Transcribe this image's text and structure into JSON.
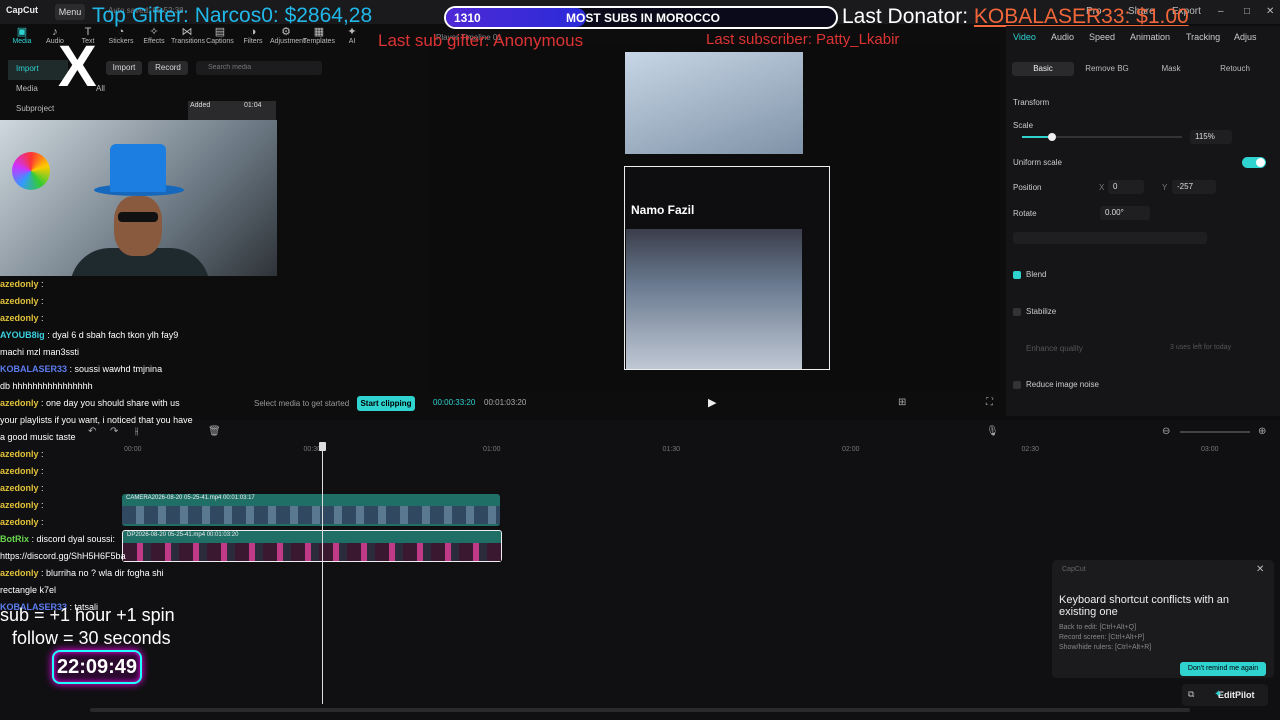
{
  "app": {
    "name": "CapCut",
    "menu_label": "Menu",
    "autosave": "Auto saved: 05:52:38"
  },
  "window_buttons": [
    "Pro",
    "Share",
    "Export"
  ],
  "tool_tabs": [
    {
      "label": "Media",
      "icon": "media-icon",
      "active": true
    },
    {
      "label": "Audio",
      "icon": "audio-icon"
    },
    {
      "label": "Text",
      "icon": "text-icon"
    },
    {
      "label": "Stickers",
      "icon": "stickers-icon"
    },
    {
      "label": "Effects",
      "icon": "effects-icon"
    },
    {
      "label": "Transitions",
      "icon": "transitions-icon"
    },
    {
      "label": "Captions",
      "icon": "captions-icon"
    },
    {
      "label": "Filters",
      "icon": "filters-icon"
    },
    {
      "label": "Adjustment",
      "icon": "adjustment-icon"
    },
    {
      "label": "Templates",
      "icon": "templates-icon"
    },
    {
      "label": "AI",
      "icon": "ai-icon"
    }
  ],
  "left_nav": [
    {
      "label": "Import",
      "active": true
    },
    {
      "label": "Media"
    },
    {
      "label": "Subproject"
    }
  ],
  "media_toolbar": {
    "import": "Import",
    "record": "Record",
    "search_placeholder": "Search media",
    "filter_all": "All"
  },
  "media_items": [
    {
      "badge": "Added",
      "duration": "01:04"
    }
  ],
  "overlay": {
    "top_gifter": "Top Gifter: Narcos0: $2864,28",
    "sub_count": "1310",
    "sub_goal": "MOST SUBS IN MOROCCO",
    "sub_goal_progress": 0.36,
    "last_donator_label": "Last Donator:",
    "last_donator_value": "KOBALASER33: $1.00",
    "last_sub_gifter": "Last sub gifter: Anonymous",
    "last_subscriber": "Last subscriber: Patty_Lkabir",
    "sub_rules_1": "sub  = +1 hour +1 spin",
    "sub_rules_2": "follow = 30 seconds",
    "timer": "22:09:49"
  },
  "chat": [
    {
      "name": "azedonly",
      "msg": ":",
      "color": "yellow"
    },
    {
      "name": "azedonly",
      "msg": ":",
      "color": "yellow"
    },
    {
      "name": "azedonly",
      "msg": ":",
      "color": "yellow"
    },
    {
      "name": "AYOUB8ig",
      "msg": ": dyal 6 d sbah fach tkon ylh fay9",
      "color": "cyan"
    },
    {
      "name": "",
      "msg": "machi mzl man3ssti",
      "color": "yellow"
    },
    {
      "name": "KOBALASER33",
      "msg": ": soussi wawhd tmjnina",
      "color": "blue"
    },
    {
      "name": "",
      "msg": "db hhhhhhhhhhhhhhhh",
      "color": "yellow"
    },
    {
      "name": "azedonly",
      "msg": ": one day you should share with us",
      "color": "yellow"
    },
    {
      "name": "",
      "msg": "your playlists if you want, i noticed that you have",
      "color": "yellow"
    },
    {
      "name": "",
      "msg": "a good music taste",
      "color": "yellow"
    },
    {
      "name": "azedonly",
      "msg": ":",
      "color": "yellow"
    },
    {
      "name": "azedonly",
      "msg": ":",
      "color": "yellow"
    },
    {
      "name": "azedonly",
      "msg": ":",
      "color": "yellow"
    },
    {
      "name": "azedonly",
      "msg": ":",
      "color": "yellow"
    },
    {
      "name": "azedonly",
      "msg": ":",
      "color": "yellow"
    },
    {
      "name": "BotRix",
      "msg": ": discord dyal soussi:",
      "color": "green"
    },
    {
      "name": "",
      "msg": "https://discord.gg/ShH5H6F5ba",
      "color": "yellow"
    },
    {
      "name": "azedonly",
      "msg": ": blurriha no ? wla dir fogha shi",
      "color": "yellow"
    },
    {
      "name": "",
      "msg": "rectangle k7el",
      "color": "yellow"
    },
    {
      "name": "KOBALASER33",
      "msg": ": tatsali",
      "color": "blue"
    }
  ],
  "player": {
    "title": "Player  Timeline 01",
    "caption": "Namo Fazil",
    "time_current": "00:00:33:20",
    "time_total": "00:01:03:20",
    "select_media": "Select media to get started",
    "start_clipping": "Start clipping"
  },
  "right_panel": {
    "tabs": [
      {
        "label": "Video",
        "active": true
      },
      {
        "label": "Audio"
      },
      {
        "label": "Speed"
      },
      {
        "label": "Animation"
      },
      {
        "label": "Tracking"
      },
      {
        "label": "Adjus"
      }
    ],
    "subtabs": [
      {
        "label": "Basic",
        "active": true
      },
      {
        "label": "Remove BG"
      },
      {
        "label": "Mask"
      },
      {
        "label": "Retouch"
      }
    ],
    "transform": "Transform",
    "scale_label": "Scale",
    "scale_value": "115%",
    "scale_fraction": 0.19,
    "uniform_scale": "Uniform scale",
    "position_label": "Position",
    "pos_x_label": "X",
    "pos_x": "0",
    "pos_y_label": "Y",
    "pos_y": "-257",
    "rotate_label": "Rotate",
    "rotate_value": "0.00°",
    "blend": "Blend",
    "stabilize": "Stabilize",
    "enhance_quality": "Enhance quality",
    "uses_left": "3 uses left for today",
    "reduce_noise": "Reduce image noise"
  },
  "timeline": {
    "ruler": [
      "00:00",
      "00:30",
      "01:00",
      "01:30",
      "02:00",
      "02:30",
      "03:00"
    ],
    "track1_label": "CAMERA2026-08-20 05-25-41.mp4  00:01:03:17",
    "track2_label": "DP2026-08-20 05-25-41.mp4  00:01:03:20"
  },
  "popup": {
    "brand": "CapCut",
    "title": "Keyboard shortcut conflicts with an existing one",
    "line1": "Back to edit: [Ctrl+Alt+Q]",
    "line2": "Record screen: [Ctrl+Alt+P]",
    "line3": "Show/hide rulers: [Ctrl+Alt+R]",
    "dismiss": "Don't remind me again",
    "editpilot": "EditPilot"
  },
  "colors": {
    "accent": "#2fd3d0",
    "overlay_blue": "#21b7e8",
    "overlay_red": "#d33"
  }
}
